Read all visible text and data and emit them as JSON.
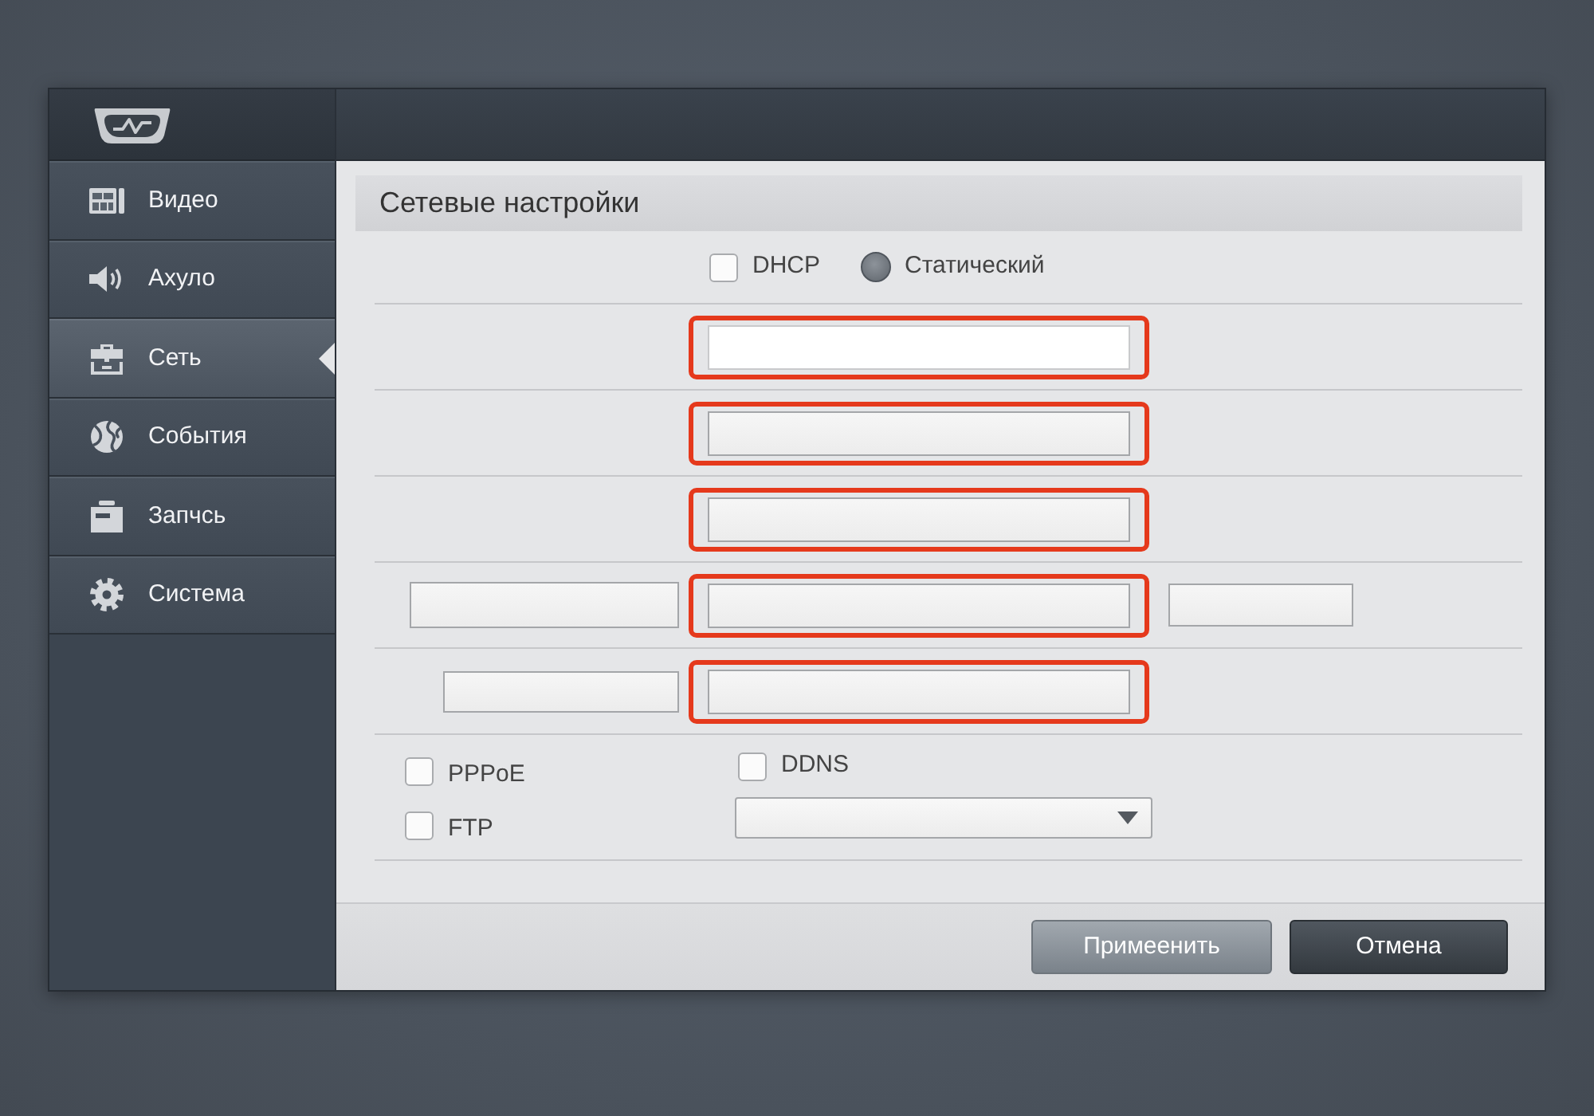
{
  "sidebar": {
    "items": [
      {
        "label": "Видео",
        "selected": false
      },
      {
        "label": "Ахуло",
        "selected": false
      },
      {
        "label": "Сеть",
        "selected": true
      },
      {
        "label": "События",
        "selected": false
      },
      {
        "label": "Запчсь",
        "selected": false
      },
      {
        "label": "Система",
        "selected": false
      }
    ]
  },
  "panel": {
    "title": "Сетевые настройки"
  },
  "connection_mode": {
    "options": [
      {
        "kind": "checkbox",
        "label": "DHCP",
        "checked": false
      },
      {
        "kind": "radio",
        "label": "Статический",
        "checked": true
      }
    ]
  },
  "address_rows": [
    {
      "center_field": {
        "highlighted": true,
        "focused": true
      }
    },
    {
      "center_field": {
        "highlighted": true,
        "focused": false
      }
    },
    {
      "center_field": {
        "highlighted": true,
        "focused": false
      }
    },
    {
      "left_field": {
        "highlighted": false,
        "focused": false
      },
      "center_field": {
        "highlighted": true,
        "focused": false
      },
      "right_field": {
        "highlighted": false,
        "focused": false
      }
    },
    {
      "left_field": {
        "highlighted": false,
        "focused": false
      },
      "center_field": {
        "highlighted": true,
        "focused": false
      }
    }
  ],
  "services": [
    {
      "label": "PPPoE",
      "checked": false
    },
    {
      "label": "FTP",
      "checked": false
    }
  ],
  "ddns": {
    "label": "DDNS",
    "checked": false,
    "dropdown": {
      "expanded": false
    }
  },
  "buttons": [
    {
      "kind": "muted",
      "label": "Примеенить"
    },
    {
      "kind": "dark",
      "label": "Отмена"
    }
  ]
}
